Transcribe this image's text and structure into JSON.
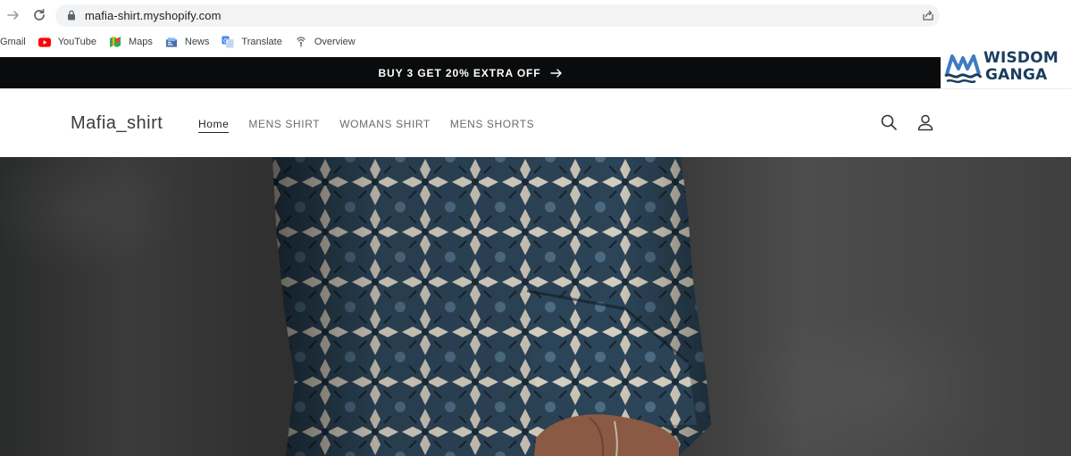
{
  "browser": {
    "url": "mafia-shirt.myshopify.com",
    "bookmarks": [
      {
        "label": "Gmail",
        "icon": "gmail-icon"
      },
      {
        "label": "YouTube",
        "icon": "youtube-icon"
      },
      {
        "label": "Maps",
        "icon": "maps-icon"
      },
      {
        "label": "News",
        "icon": "news-icon"
      },
      {
        "label": "Translate",
        "icon": "translate-icon"
      },
      {
        "label": "Overview",
        "icon": "overview-icon"
      }
    ]
  },
  "announcement": {
    "text": "BUY 3 GET 20% EXTRA OFF",
    "background": "#0a0b0c"
  },
  "watermark": {
    "line1": "WISDOM",
    "line2": "GANGA",
    "color": "#1a3d5e"
  },
  "shop": {
    "title": "Mafia_shirt",
    "menu": [
      {
        "label": "Home",
        "active": true
      },
      {
        "label": "MENS SHIRT",
        "active": false
      },
      {
        "label": "WOMANS SHIRT",
        "active": false
      },
      {
        "label": "MENS SHORTS",
        "active": false
      }
    ],
    "icons": [
      "search-icon",
      "account-icon"
    ]
  }
}
